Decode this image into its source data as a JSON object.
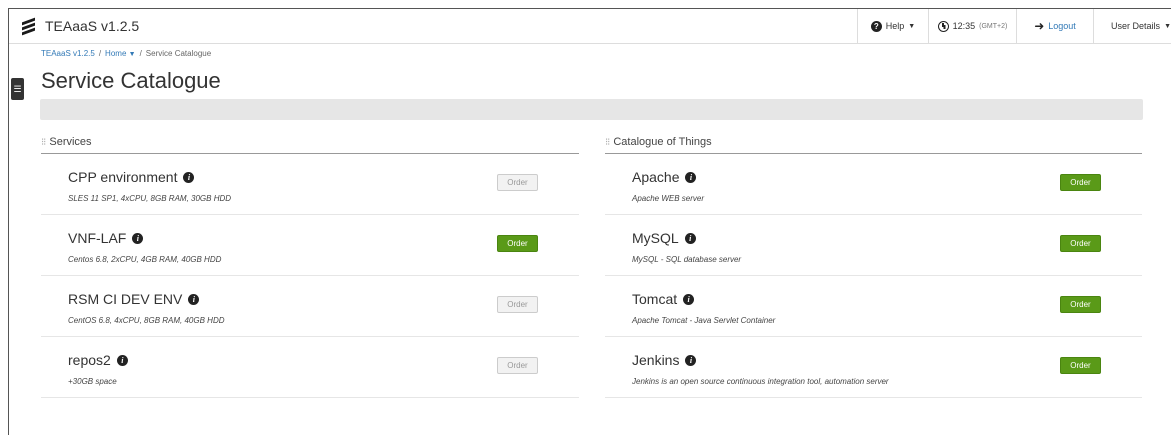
{
  "app": {
    "title": "TEAaaS v1.2.5",
    "nav": {
      "help_label": "Help",
      "time": "12:35",
      "timezone": "(GMT+2)",
      "logout_label": "Logout",
      "user_label": "User Details"
    }
  },
  "breadcrumb": {
    "root": "TEAaaS v1.2.5",
    "home": "Home",
    "current": "Service Catalogue",
    "separator": "/"
  },
  "page": {
    "title": "Service Catalogue"
  },
  "services": {
    "header": "Services",
    "items": [
      {
        "name": "CPP environment",
        "desc": "SLES 11 SP1, 4xCPU, 8GB RAM, 30GB HDD",
        "order_label": "Order",
        "enabled": false
      },
      {
        "name": "VNF-LAF",
        "desc": "Centos 6.8, 2xCPU, 4GB RAM, 40GB HDD",
        "order_label": "Order",
        "enabled": true
      },
      {
        "name": "RSM CI DEV ENV",
        "desc": "CentOS 6.8, 4xCPU, 8GB RAM, 40GB HDD",
        "order_label": "Order",
        "enabled": false
      },
      {
        "name": "repos2",
        "desc": "+30GB space",
        "order_label": "Order",
        "enabled": false
      }
    ]
  },
  "catalogue": {
    "header": "Catalogue of Things",
    "items": [
      {
        "name": "Apache",
        "desc": "Apache WEB server",
        "order_label": "Order",
        "enabled": true
      },
      {
        "name": "MySQL",
        "desc": "MySQL - SQL database server",
        "order_label": "Order",
        "enabled": true
      },
      {
        "name": "Tomcat",
        "desc": "Apache Tomcat - Java Servlet Container",
        "order_label": "Order",
        "enabled": true
      },
      {
        "name": "Jenkins",
        "desc": "Jenkins is an open source continuous integration tool, automation server",
        "order_label": "Order",
        "enabled": true
      }
    ]
  },
  "colors": {
    "order_active": "#5a9a18",
    "link": "#337ab7"
  },
  "icons": [
    "logo-icon",
    "help-icon",
    "clock-icon",
    "logout-icon",
    "chevron-down-icon",
    "menu-toggle-icon",
    "info-icon",
    "grip-icon"
  ]
}
